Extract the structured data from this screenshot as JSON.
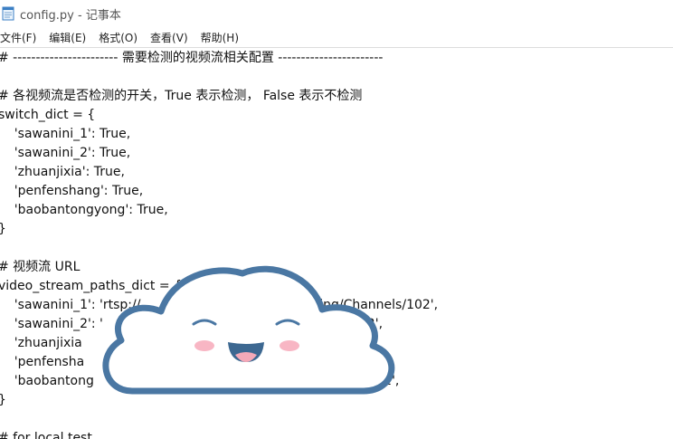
{
  "window": {
    "title": "config.py - 记事本",
    "icon": "notepad-icon"
  },
  "menu": {
    "items": [
      "文件(F)",
      "编辑(E)",
      "格式(O)",
      "查看(V)",
      "帮助(H)"
    ]
  },
  "editor": {
    "lines": [
      "# ----------------------- 需要检测的视频流相关配置 -----------------------",
      "",
      "# 各视频流是否检测的开关，True 表示检测， False 表示不检测",
      "switch_dict = {",
      "    'sawanini_1': True,",
      "    'sawanini_2': True,",
      "    'zhuanjixia': True,",
      "    'penfenshang': True,",
      "    'baobantongyong': True,",
      "}",
      "",
      "# 视频流 URL",
      "video_stream_paths_dict = {",
      "    'sawanini_1': 'rtsp://                              3/Streaming/Channels/102',",
      "    'sawanini_2': '                                     ming/Channels/102',",
      "    'zhuanjixia                                         g/Channels/102',",
      "    'penfensha                                          ming/Channels/102',",
      "    'baobantong                                  /Streaming/Channels/102',",
      "}",
      "",
      "# for local test"
    ]
  },
  "overlay": {
    "icon": "smiling-cloud-icon",
    "colors": {
      "outline": "#4a77a3",
      "fill": "#ffffff",
      "cheek": "#f8b6c4",
      "mouth": "#3d6891",
      "tongue": "#f5a9b8"
    }
  }
}
